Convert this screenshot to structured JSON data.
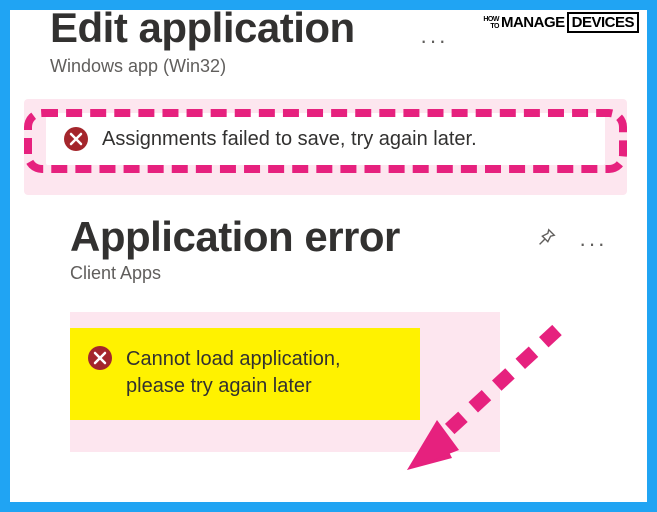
{
  "logo": {
    "how": "HOW",
    "to": "TO",
    "manage": "MANAGE",
    "devices": "DEVICES"
  },
  "panel1": {
    "title": "Edit application",
    "subtitle": "Windows app (Win32)",
    "more": "···"
  },
  "banner1": {
    "text": "Assignments failed to save, try again later."
  },
  "panel2": {
    "title": "Application error",
    "subtitle": "Client Apps",
    "more": "···"
  },
  "banner2": {
    "text": "Cannot load application, please try again later"
  }
}
